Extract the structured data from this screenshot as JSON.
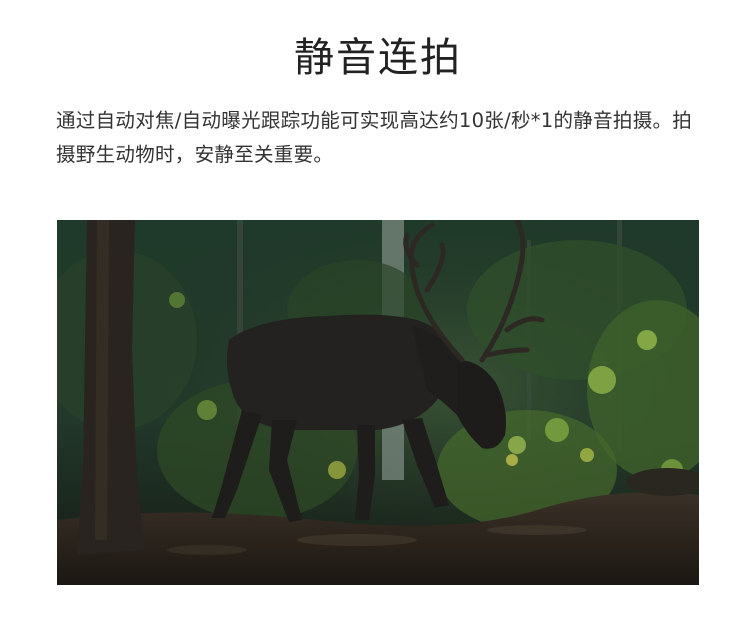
{
  "page": {
    "title": "静音连拍",
    "description": "通过自动对焦/自动曝光跟踪功能可实现高达约10张/秒*1的静音拍摄。拍摄野生动物时，安静至关重要。"
  },
  "photo": {
    "subject": "reindeer-in-forest"
  },
  "colors": {
    "background": "#ffffff",
    "title_text": "#222222",
    "body_text": "#333333",
    "forest_dark": "#1c2a20",
    "foliage": "#6f9a3a",
    "animal": "#232220"
  }
}
